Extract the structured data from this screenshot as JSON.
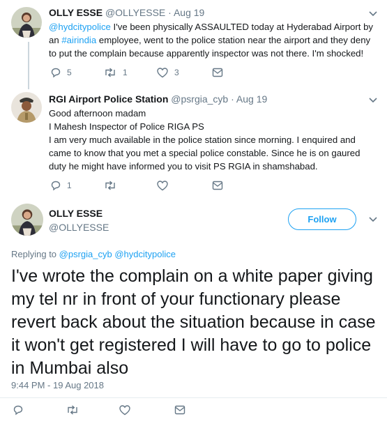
{
  "tweet1": {
    "name": "OLLY ESSE",
    "handle": "@OLLYESSE",
    "separator": "·",
    "time": "Aug 19",
    "mention": "@hydcitypolice",
    "text_a": " I've been physically ASSAULTED today at Hyderabad Airport by an ",
    "hashtag": "#airindia",
    "text_b": " employee, went to the police station near the airport and they deny to put the complain because apparently inspector was not there. I'm shocked!",
    "replies": "5",
    "retweets": "1",
    "likes": "3"
  },
  "tweet2": {
    "name": "RGI Airport Police Station",
    "handle": "@psrgia_cyb",
    "separator": "·",
    "time": "Aug 19",
    "line1": "Good afternoon madam",
    "line2": "I Mahesh Inspector of Police RIGA PS",
    "line3": "I am very much available in the police station since morning. I enquired and came to know that you met a special police constable. Since he is on gaured duty he might have informed you to visit PS RGIA in shamshabad.",
    "replies": "1"
  },
  "main_tweet": {
    "name": "OLLY ESSE",
    "handle": "@OLLYESSE",
    "follow_label": "Follow",
    "replying_prefix": "Replying to ",
    "replying_to_1": "@psrgia_cyb",
    "replying_to_2": "@hydcitypolice",
    "text": "I've wrote the complain on a white paper giving my tel nr in front of your functionary please revert back about the situation because in case it won't get registered I will have to go to police in Mumbai also",
    "timestamp": "9:44 PM - 19 Aug 2018"
  },
  "colors": {
    "accent": "#1da1f2",
    "muted": "#657786",
    "text": "#14171a",
    "border": "#e6ecf0"
  },
  "icons": [
    "reply-icon",
    "retweet-icon",
    "like-icon",
    "message-icon",
    "chevron-down-icon",
    "avatar"
  ]
}
